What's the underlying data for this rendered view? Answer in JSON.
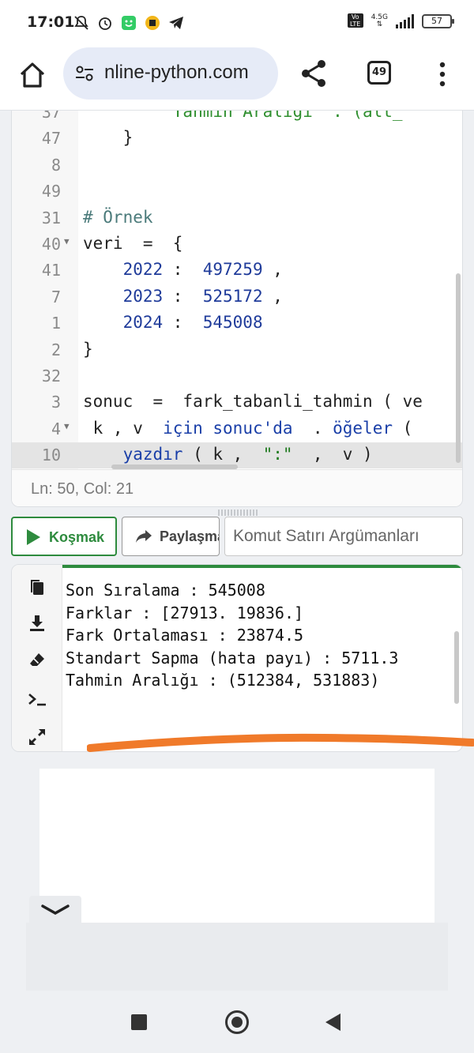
{
  "status_bar": {
    "time": "17:01",
    "icons": [
      "bell-off-icon",
      "alarm-icon",
      "app-face-icon",
      "coin-icon",
      "telegram-icon"
    ],
    "network": "4.5G",
    "volte": "Vo LTE",
    "battery": "57"
  },
  "browser": {
    "url": "nline-python.com",
    "tab_count": "49"
  },
  "editor": {
    "lines": [
      {
        "num": "37",
        "fold": false,
        "tokens": [
          {
            "t": "        \"Tahmin Aralığı\" : (alt_",
            "c": "green"
          }
        ]
      },
      {
        "num": "47",
        "fold": false,
        "tokens": [
          {
            "t": "    }",
            "c": ""
          }
        ]
      },
      {
        "num": "8",
        "fold": false,
        "tokens": []
      },
      {
        "num": "49",
        "fold": false,
        "tokens": []
      },
      {
        "num": "31",
        "fold": false,
        "tokens": [
          {
            "t": "# Örnek",
            "c": "com"
          }
        ]
      },
      {
        "num": "40",
        "fold": true,
        "tokens": [
          {
            "t": "veri  =  {",
            "c": ""
          }
        ]
      },
      {
        "num": "41",
        "fold": false,
        "tokens": [
          {
            "t": "    ",
            "c": ""
          },
          {
            "t": "2022",
            "c": "num"
          },
          {
            "t": " :  ",
            "c": ""
          },
          {
            "t": "497259",
            "c": "num"
          },
          {
            "t": " ,",
            "c": ""
          }
        ]
      },
      {
        "num": "7",
        "fold": false,
        "tokens": [
          {
            "t": "    ",
            "c": ""
          },
          {
            "t": "2023",
            "c": "num"
          },
          {
            "t": " :  ",
            "c": ""
          },
          {
            "t": "525172",
            "c": "num"
          },
          {
            "t": " ,",
            "c": ""
          }
        ]
      },
      {
        "num": "1",
        "fold": false,
        "tokens": [
          {
            "t": "    ",
            "c": ""
          },
          {
            "t": "2024",
            "c": "num"
          },
          {
            "t": " :  ",
            "c": ""
          },
          {
            "t": "545008",
            "c": "num"
          }
        ]
      },
      {
        "num": "2",
        "fold": false,
        "tokens": [
          {
            "t": "}",
            "c": ""
          }
        ]
      },
      {
        "num": "32",
        "fold": false,
        "tokens": []
      },
      {
        "num": "3",
        "fold": false,
        "tokens": [
          {
            "t": "sonuc  =  fark_tabanli_tahmin ( ve",
            "c": ""
          }
        ]
      },
      {
        "num": "4",
        "fold": true,
        "tokens": [
          {
            "t": " k , v  ",
            "c": ""
          },
          {
            "t": "için",
            "c": "kw"
          },
          {
            "t": " ",
            "c": ""
          },
          {
            "t": "sonuc'da",
            "c": "kw"
          },
          {
            "t": "  . ",
            "c": ""
          },
          {
            "t": "öğeler",
            "c": "kw"
          },
          {
            "t": " (",
            "c": ""
          }
        ]
      },
      {
        "num": "10",
        "fold": false,
        "active": true,
        "tokens": [
          {
            "t": "    ",
            "c": ""
          },
          {
            "t": "yazdır",
            "c": "kw"
          },
          {
            "t": " ( k ,  ",
            "c": ""
          },
          {
            "t": "\":\"",
            "c": "str"
          },
          {
            "t": "  ,  v )",
            "c": ""
          }
        ]
      }
    ],
    "cursor_position": "Ln: 50, Col: 21"
  },
  "toolbar": {
    "run_label": "Koşmak",
    "share_label": "Paylaşma",
    "args_placeholder": "Komut Satırı Argümanları"
  },
  "output": {
    "lines": [
      "Son Sıralama : 545008",
      "Farklar : [27913. 19836.]",
      "Fark Ortalaması : 23874.5",
      "Standart Sapma (hata payı) : 5711.3",
      "Tahmin Aralığı : (512384, 531883)"
    ],
    "tools": [
      "copy-icon",
      "download-icon",
      "eraser-icon",
      "terminal-icon",
      "expand-icon"
    ]
  },
  "colors": {
    "run_green": "#2e8b3e",
    "annotation_orange": "#f07a2a"
  }
}
